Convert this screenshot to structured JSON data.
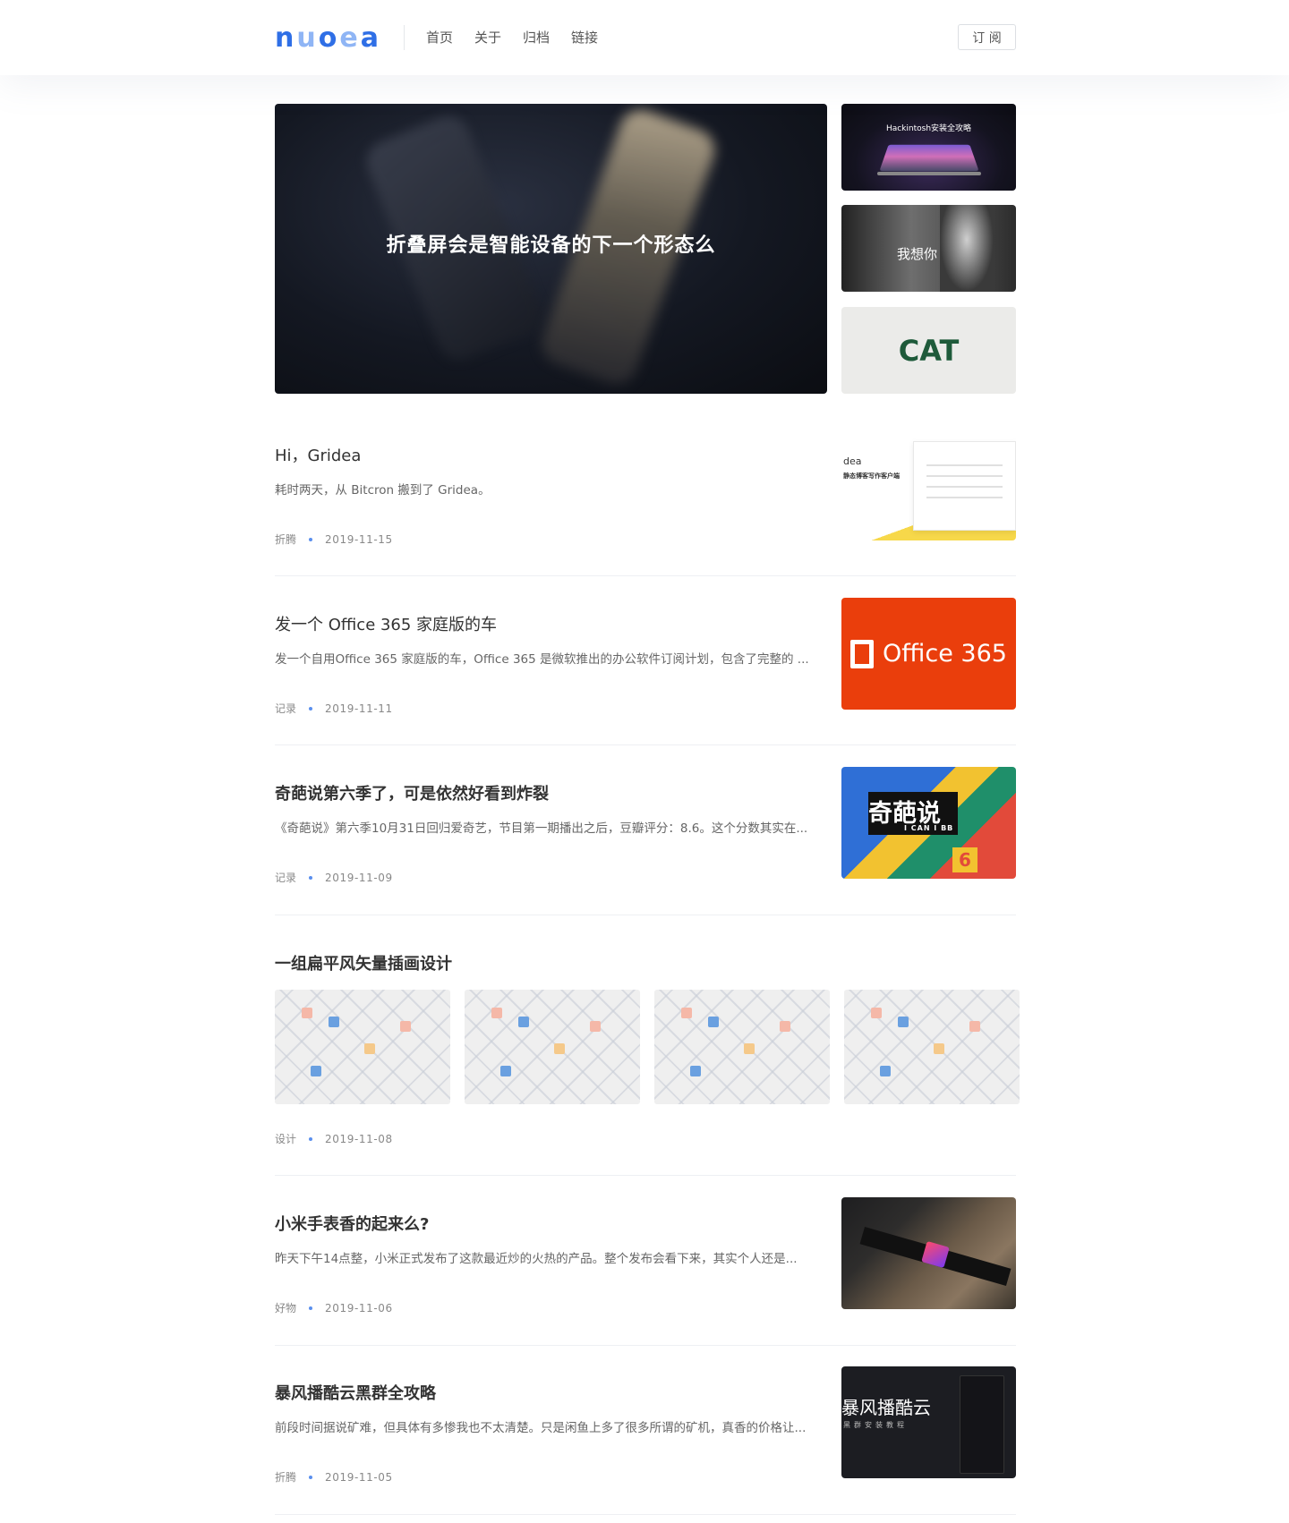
{
  "header": {
    "logo": [
      "n",
      "u",
      "o",
      "e",
      "a"
    ],
    "nav": [
      "首页",
      "关于",
      "归档",
      "链接"
    ],
    "subscribe_label": "订 阅"
  },
  "hero": {
    "main_title": "折叠屏会是智能设备的下一个形态么",
    "side": [
      {
        "label": "Hackintosh安装全攻略"
      },
      {
        "label": "我想你"
      },
      {
        "label": "CAT"
      }
    ]
  },
  "posts": [
    {
      "title": "Hi，Gridea",
      "excerpt": "耗时两天，从 Bitcron 搬到了 Gridea。",
      "category": "折腾",
      "date": "2019-11-15",
      "thumb": {
        "t1": "dea",
        "t2": "静态博客写作客户端"
      }
    },
    {
      "title": "发一个 Office 365 家庭版的车",
      "excerpt": "发一个自用Office 365 家庭版的车，Office 365 是微软推出的办公软件订阅计划，包含了完整的 ...",
      "category": "记录",
      "date": "2019-11-11",
      "thumb": {
        "text": "Office 365"
      }
    },
    {
      "title": "奇葩说第六季了，可是依然好看到炸裂",
      "excerpt": "《奇葩说》第六季10月31日回归爱奇艺，节目第一期播出之后，豆瓣评分：8.6。这个分数其实在...",
      "category": "记录",
      "date": "2019-11-09",
      "thumb": {
        "text": "奇葩说",
        "sub": "I CAN I BB",
        "num": "6"
      }
    },
    {
      "title": "一组扁平风矢量插画设计",
      "category": "设计",
      "date": "2019-11-08",
      "gallery_count": 4
    },
    {
      "title": "小米手表香的起来么?",
      "excerpt": "昨天下午14点整，小米正式发布了这款最近炒的火热的产品。整个发布会看下来，其实个人还是...",
      "category": "好物",
      "date": "2019-11-06"
    },
    {
      "title": "暴风播酷云黑群全攻略",
      "excerpt": "前段时间据说矿难，但具体有多惨我也不太清楚。只是闲鱼上多了很多所谓的矿机，真香的价格让...",
      "category": "折腾",
      "date": "2019-11-05",
      "thumb": {
        "text": "暴风播酷云",
        "sub": "黑群安装教程"
      }
    }
  ],
  "colors": {
    "accent": "#2f6fe6",
    "dot": "#5a8fee",
    "office": "#ea3e0c"
  }
}
